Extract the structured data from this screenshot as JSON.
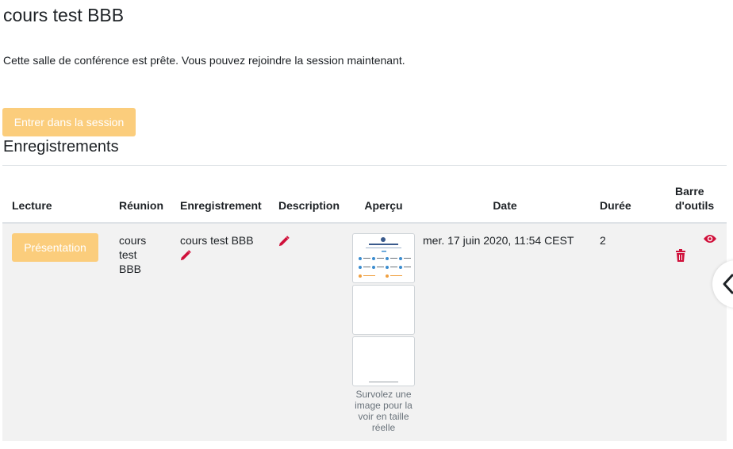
{
  "page": {
    "title": "cours test BBB",
    "status_message": "Cette salle de conférence est prête. Vous pouvez rejoindre la session maintenant.",
    "join_button_label": "Entrer dans la session",
    "recordings_heading": "Enregistrements"
  },
  "table": {
    "headers": {
      "playback": "Lecture",
      "meeting": "Réunion",
      "recording": "Enregistrement",
      "description": "Description",
      "preview": "Aperçu",
      "date": "Date",
      "duration": "Durée",
      "toolbar": "Barre d'outils"
    },
    "rows": [
      {
        "playback_button": "Présentation",
        "meeting": "cours test BBB",
        "recording": "cours test BBB",
        "description": "",
        "preview_hint": "Survolez une image pour la voir en taille réelle",
        "date": "mer. 17 juin 2020, 11:54 CEST",
        "duration": "2"
      }
    ]
  },
  "icons": {
    "edit": "pencil-icon",
    "view": "eye-icon",
    "delete": "trash-icon",
    "sidebar_toggle": "chevron-left-icon"
  },
  "colors": {
    "button_bg": "#fbcd7c",
    "icon_accent": "#d0103a",
    "row_bg": "#f2f2f2"
  }
}
